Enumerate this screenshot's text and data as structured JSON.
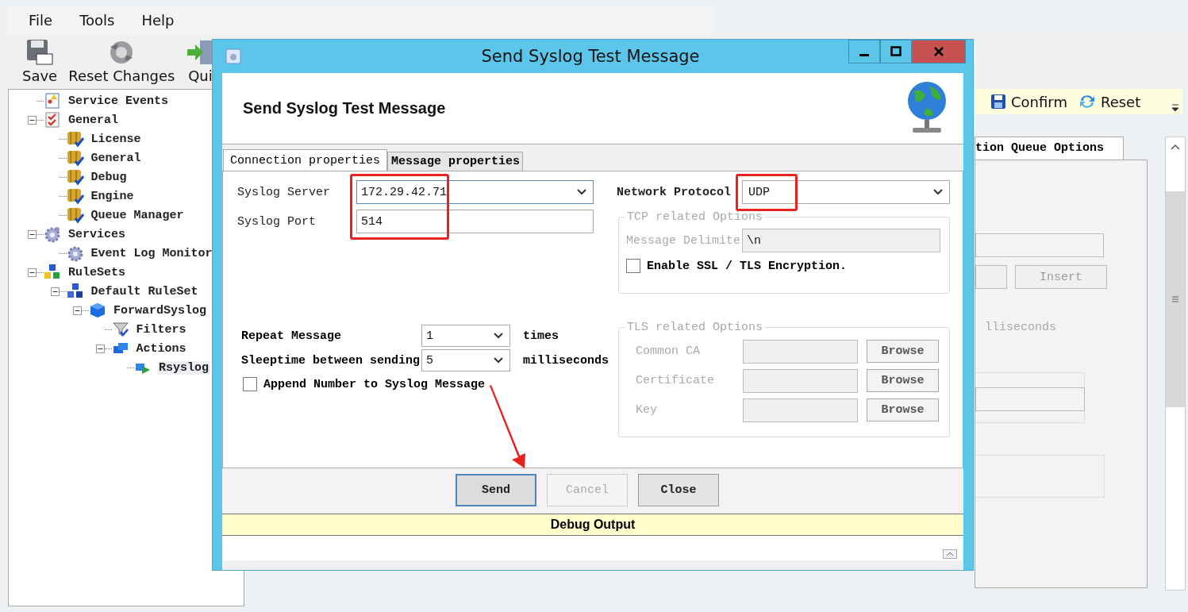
{
  "menu": [
    {
      "label": "File"
    },
    {
      "label": "Tools"
    },
    {
      "label": "Help"
    }
  ],
  "toolbar": [
    {
      "label": "Save",
      "kind": "save"
    },
    {
      "label": "Reset Changes",
      "kind": "reset"
    },
    {
      "label": "Qui",
      "kind": "quit"
    }
  ],
  "tree": [
    {
      "label": "Service Events",
      "kind": "events",
      "selected": false
    },
    {
      "label": "General",
      "kind": "checklist",
      "selected": false,
      "expanded": true,
      "children": [
        {
          "label": "License",
          "kind": "module",
          "selected": false
        },
        {
          "label": "General",
          "kind": "module",
          "selected": false
        },
        {
          "label": "Debug",
          "kind": "module",
          "selected": false
        },
        {
          "label": "Engine",
          "kind": "module",
          "selected": false
        },
        {
          "label": "Queue Manager",
          "kind": "module",
          "selected": false
        }
      ]
    },
    {
      "label": "Services",
      "kind": "gears",
      "selected": false,
      "expanded": true,
      "children": [
        {
          "label": "Event Log Monitor",
          "kind": "gear",
          "selected": false
        }
      ]
    },
    {
      "label": "RuleSets",
      "kind": "rulesets",
      "selected": false,
      "expanded": true,
      "children": [
        {
          "label": "Default RuleSet",
          "kind": "ruleset",
          "selected": false,
          "expanded": true,
          "children": [
            {
              "label": "ForwardSyslog",
              "kind": "cube",
              "selected": false,
              "expanded": true,
              "children": [
                {
                  "label": "Filters",
                  "kind": "filter",
                  "selected": false
                },
                {
                  "label": "Actions",
                  "kind": "actions",
                  "selected": false,
                  "expanded": true,
                  "children": [
                    {
                      "label": "Rsyslog",
                      "kind": "action",
                      "selected": true
                    }
                  ]
                }
              ]
            }
          ]
        }
      ]
    }
  ],
  "background_panel": {
    "toolbar": [
      {
        "label": "Confirm",
        "kind": "save"
      },
      {
        "label": "Reset",
        "kind": "refresh"
      }
    ],
    "tab": "tion Queue Options",
    "button": "Insert",
    "unit": "lliseconds"
  },
  "dialog": {
    "title": "Send Syslog Test Message",
    "heading": "Send Syslog Test Message",
    "tabs": [
      {
        "label": "Connection properties",
        "selected": true
      },
      {
        "label": "Message properties",
        "selected": false
      }
    ],
    "syslog_server": {
      "label": "Syslog Server",
      "value": "172.29.42.71"
    },
    "syslog_port": {
      "label": "Syslog Port",
      "value": "514"
    },
    "network_protocol": {
      "label": "Network Protocol",
      "value": "UDP"
    },
    "tcp_options": {
      "title": "TCP related Options",
      "disabled": true,
      "delimiter": {
        "label": "Message Delimite",
        "value": "\\n"
      },
      "ssl": {
        "label": "Enable SSL / TLS Encryption.",
        "checked": false
      }
    },
    "tls_options": {
      "title": "TLS related Options",
      "disabled": true,
      "rows": [
        {
          "label": "Common CA",
          "button": "Browse"
        },
        {
          "label": "Certificate",
          "button": "Browse"
        },
        {
          "label": "Key",
          "button": "Browse"
        }
      ]
    },
    "repeat": {
      "label": "Repeat Message",
      "value": "1",
      "unit": "times"
    },
    "sleeptime": {
      "label": "Sleeptime between sending",
      "value": "5",
      "unit": "milliseconds"
    },
    "append_number": {
      "label": "Append Number to Syslog Message",
      "checked": false
    },
    "buttons": [
      {
        "label": "Send",
        "disabled": false,
        "default": true
      },
      {
        "label": "Cancel",
        "disabled": true,
        "default": false
      },
      {
        "label": "Close",
        "disabled": false,
        "default": false
      }
    ],
    "debug_output": {
      "title": "Debug Output"
    }
  }
}
